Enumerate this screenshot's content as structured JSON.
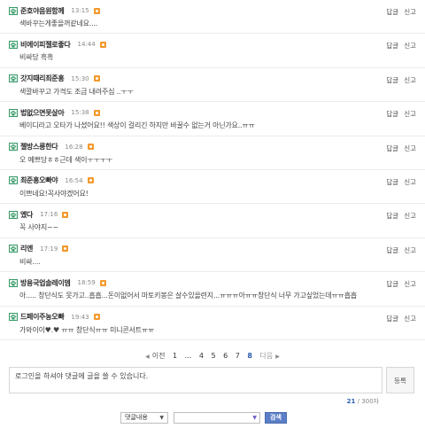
{
  "comments": [
    {
      "author": "준호야음원함께",
      "time": "13:15",
      "text": "색바꾸는게좋을꺼같네요...."
    },
    {
      "author": "비에이피젤로좋다",
      "time": "14:44",
      "text": "비싸당 흑흑"
    },
    {
      "author": "갓지때리최준홍",
      "time": "15:30",
      "text": "색깔바꾸고 가격도 조금 내려주심 ..ㅜㅜ"
    },
    {
      "author": "법없으면못살아",
      "time": "15:38",
      "text": "베이디라고 오타가 나셨어요!! 색상이 걸리긴 하지만 바꿀수 없는거 아닌가요..ㅠㅠ"
    },
    {
      "author": "젤방스릉한다",
      "time": "16:28",
      "text": "오 예쁘당ㅎㅎ근데 색이ㅜㅜㅜㅜ"
    },
    {
      "author": "최준홍오빠야",
      "time": "16:54",
      "text": "이쁘네요!꼭사야겠어요!"
    },
    {
      "author": "옜다",
      "time": "17:16",
      "text": "꼭 사야지~~"
    },
    {
      "author": "리엔",
      "time": "17:19",
      "text": "비싸...."
    },
    {
      "author": "방용국업솔레이뎀",
      "time": "18:59",
      "text": "아..... 창단식도 못가고..흡흡...돈이없어서 마토키봉은 살수있을련지...ㅠㅠㅠ아ㅠㅠ창단식 너무 가고싶었는데ㅠㅠ흡흡"
    },
    {
      "author": "드페이주농오빠",
      "time": "19:43",
      "text": "가와이이♥.♥ ㅠㅠ 창단식ㅠㅠ 미니콘서트ㅠㅠ"
    }
  ],
  "actions": {
    "reply": "답글",
    "report": "신고"
  },
  "pagination": {
    "prev": "이전",
    "pages": [
      "1",
      "...",
      "4",
      "5",
      "6",
      "7",
      "8"
    ],
    "current": "8",
    "next": "다음"
  },
  "reply": {
    "placeholder": "로그인을 하셔야 댓글에 글을 쓸 수 있습니다.",
    "button": "등록",
    "count": "21",
    "max": "/ 300자"
  },
  "search": {
    "scope": "댓글내용",
    "button": "검색"
  },
  "colors": {
    "badge": "#f39a2e",
    "home_icon": "#3a9a6a",
    "link": "#2a5db0",
    "search_button": "#5b7ec7"
  }
}
